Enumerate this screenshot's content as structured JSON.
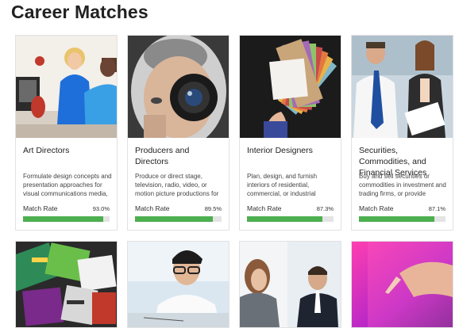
{
  "page": {
    "title": "Career Matches"
  },
  "cards": [
    {
      "title": "Art Directors",
      "description": "Formulate design concepts and presentation approaches for visual communications media,",
      "match_label": "Match Rate",
      "match_value": "93.0%",
      "match_fraction": 0.93
    },
    {
      "title": "Producers and Directors",
      "description": "Produce or direct stage, television, radio, video, or motion picture productions for",
      "match_label": "Match Rate",
      "match_value": "89.5%",
      "match_fraction": 0.895
    },
    {
      "title": "Interior Designers",
      "description": "Plan, design, and furnish interiors of residential, commercial, or industrial",
      "match_label": "Match Rate",
      "match_value": "87.3%",
      "match_fraction": 0.873
    },
    {
      "title": "Securities, Commodities, and Financial Services",
      "description": "Buy and sell securities or commodities in investment and trading firms, or provide",
      "match_label": "Match Rate",
      "match_value": "87.1%",
      "match_fraction": 0.871
    }
  ],
  "colors": {
    "bar_fill": "#4caf50",
    "bar_track": "#e4e4e4"
  }
}
